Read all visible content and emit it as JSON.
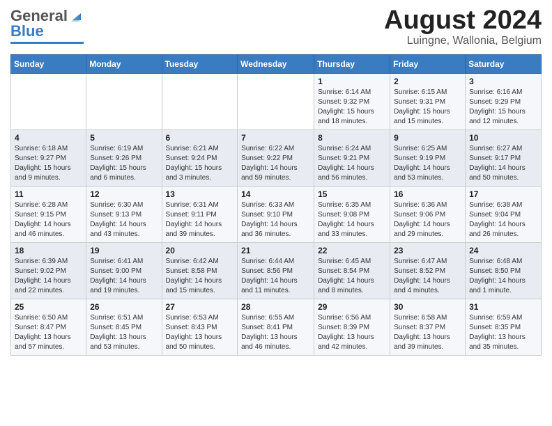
{
  "header": {
    "logo_general": "General",
    "logo_blue": "Blue",
    "month_title": "August 2024",
    "location": "Luingne, Wallonia, Belgium"
  },
  "weekdays": [
    "Sunday",
    "Monday",
    "Tuesday",
    "Wednesday",
    "Thursday",
    "Friday",
    "Saturday"
  ],
  "weeks": [
    [
      {
        "day": "",
        "info": ""
      },
      {
        "day": "",
        "info": ""
      },
      {
        "day": "",
        "info": ""
      },
      {
        "day": "",
        "info": ""
      },
      {
        "day": "1",
        "info": "Sunrise: 6:14 AM\nSunset: 9:32 PM\nDaylight: 15 hours\nand 18 minutes."
      },
      {
        "day": "2",
        "info": "Sunrise: 6:15 AM\nSunset: 9:31 PM\nDaylight: 15 hours\nand 15 minutes."
      },
      {
        "day": "3",
        "info": "Sunrise: 6:16 AM\nSunset: 9:29 PM\nDaylight: 15 hours\nand 12 minutes."
      }
    ],
    [
      {
        "day": "4",
        "info": "Sunrise: 6:18 AM\nSunset: 9:27 PM\nDaylight: 15 hours\nand 9 minutes."
      },
      {
        "day": "5",
        "info": "Sunrise: 6:19 AM\nSunset: 9:26 PM\nDaylight: 15 hours\nand 6 minutes."
      },
      {
        "day": "6",
        "info": "Sunrise: 6:21 AM\nSunset: 9:24 PM\nDaylight: 15 hours\nand 3 minutes."
      },
      {
        "day": "7",
        "info": "Sunrise: 6:22 AM\nSunset: 9:22 PM\nDaylight: 14 hours\nand 59 minutes."
      },
      {
        "day": "8",
        "info": "Sunrise: 6:24 AM\nSunset: 9:21 PM\nDaylight: 14 hours\nand 56 minutes."
      },
      {
        "day": "9",
        "info": "Sunrise: 6:25 AM\nSunset: 9:19 PM\nDaylight: 14 hours\nand 53 minutes."
      },
      {
        "day": "10",
        "info": "Sunrise: 6:27 AM\nSunset: 9:17 PM\nDaylight: 14 hours\nand 50 minutes."
      }
    ],
    [
      {
        "day": "11",
        "info": "Sunrise: 6:28 AM\nSunset: 9:15 PM\nDaylight: 14 hours\nand 46 minutes."
      },
      {
        "day": "12",
        "info": "Sunrise: 6:30 AM\nSunset: 9:13 PM\nDaylight: 14 hours\nand 43 minutes."
      },
      {
        "day": "13",
        "info": "Sunrise: 6:31 AM\nSunset: 9:11 PM\nDaylight: 14 hours\nand 39 minutes."
      },
      {
        "day": "14",
        "info": "Sunrise: 6:33 AM\nSunset: 9:10 PM\nDaylight: 14 hours\nand 36 minutes."
      },
      {
        "day": "15",
        "info": "Sunrise: 6:35 AM\nSunset: 9:08 PM\nDaylight: 14 hours\nand 33 minutes."
      },
      {
        "day": "16",
        "info": "Sunrise: 6:36 AM\nSunset: 9:06 PM\nDaylight: 14 hours\nand 29 minutes."
      },
      {
        "day": "17",
        "info": "Sunrise: 6:38 AM\nSunset: 9:04 PM\nDaylight: 14 hours\nand 26 minutes."
      }
    ],
    [
      {
        "day": "18",
        "info": "Sunrise: 6:39 AM\nSunset: 9:02 PM\nDaylight: 14 hours\nand 22 minutes."
      },
      {
        "day": "19",
        "info": "Sunrise: 6:41 AM\nSunset: 9:00 PM\nDaylight: 14 hours\nand 19 minutes."
      },
      {
        "day": "20",
        "info": "Sunrise: 6:42 AM\nSunset: 8:58 PM\nDaylight: 14 hours\nand 15 minutes."
      },
      {
        "day": "21",
        "info": "Sunrise: 6:44 AM\nSunset: 8:56 PM\nDaylight: 14 hours\nand 11 minutes."
      },
      {
        "day": "22",
        "info": "Sunrise: 6:45 AM\nSunset: 8:54 PM\nDaylight: 14 hours\nand 8 minutes."
      },
      {
        "day": "23",
        "info": "Sunrise: 6:47 AM\nSunset: 8:52 PM\nDaylight: 14 hours\nand 4 minutes."
      },
      {
        "day": "24",
        "info": "Sunrise: 6:48 AM\nSunset: 8:50 PM\nDaylight: 14 hours\nand 1 minute."
      }
    ],
    [
      {
        "day": "25",
        "info": "Sunrise: 6:50 AM\nSunset: 8:47 PM\nDaylight: 13 hours\nand 57 minutes."
      },
      {
        "day": "26",
        "info": "Sunrise: 6:51 AM\nSunset: 8:45 PM\nDaylight: 13 hours\nand 53 minutes."
      },
      {
        "day": "27",
        "info": "Sunrise: 6:53 AM\nSunset: 8:43 PM\nDaylight: 13 hours\nand 50 minutes."
      },
      {
        "day": "28",
        "info": "Sunrise: 6:55 AM\nSunset: 8:41 PM\nDaylight: 13 hours\nand 46 minutes."
      },
      {
        "day": "29",
        "info": "Sunrise: 6:56 AM\nSunset: 8:39 PM\nDaylight: 13 hours\nand 42 minutes."
      },
      {
        "day": "30",
        "info": "Sunrise: 6:58 AM\nSunset: 8:37 PM\nDaylight: 13 hours\nand 39 minutes."
      },
      {
        "day": "31",
        "info": "Sunrise: 6:59 AM\nSunset: 8:35 PM\nDaylight: 13 hours\nand 35 minutes."
      }
    ]
  ]
}
